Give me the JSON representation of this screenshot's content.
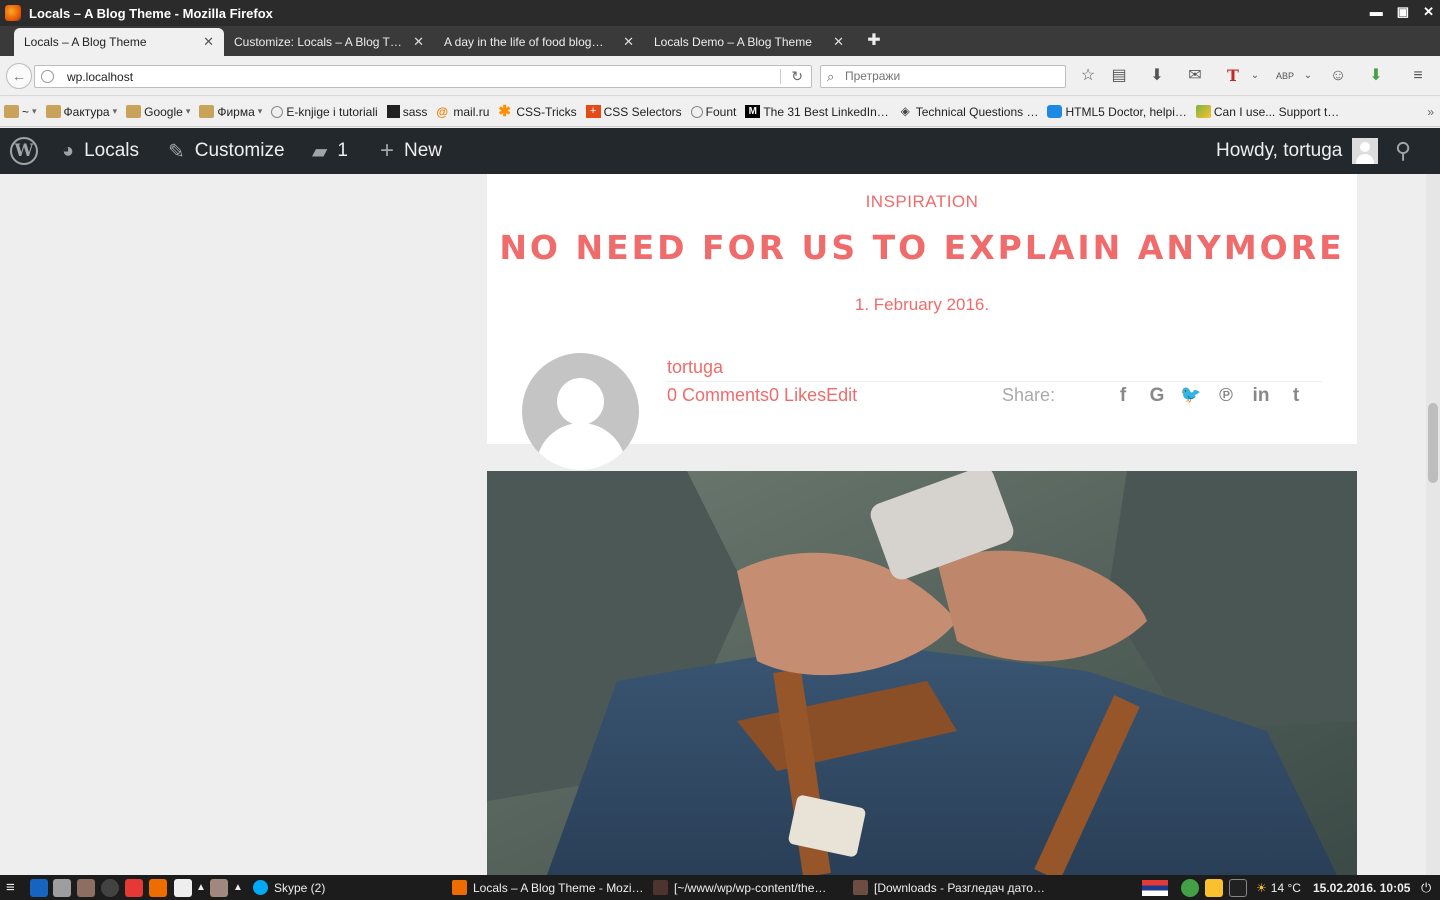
{
  "window": {
    "title": "Locals – A Blog Theme - Mozilla Firefox"
  },
  "tabs": [
    {
      "label": "Locals – A Blog Theme",
      "active": true
    },
    {
      "label": "Customize: Locals – A Blog T…",
      "active": false
    },
    {
      "label": "A day in the life of food blog…",
      "active": false
    },
    {
      "label": "Locals Demo – A Blog Theme",
      "active": false
    }
  ],
  "nav": {
    "url": "wp.localhost",
    "search_placeholder": "Претражи"
  },
  "bookmarks": [
    {
      "label": "~",
      "icon": "folder-icon",
      "dropdown": true
    },
    {
      "label": "Фактура",
      "icon": "folder-icon",
      "dropdown": true
    },
    {
      "label": "Google",
      "icon": "folder-icon",
      "dropdown": true
    },
    {
      "label": "Фирма",
      "icon": "folder-icon",
      "dropdown": true
    },
    {
      "label": "E-knjige i tutoriali",
      "icon": "globe-icon",
      "dropdown": false
    },
    {
      "label": "sass",
      "icon": "sass-icon",
      "dropdown": false
    },
    {
      "label": "mail.ru",
      "icon": "mailru-icon",
      "dropdown": false
    },
    {
      "label": "CSS-Tricks",
      "icon": "asterisk-icon",
      "dropdown": false
    },
    {
      "label": "CSS Selectors",
      "icon": "plus-icon",
      "dropdown": false
    },
    {
      "label": "Fount",
      "icon": "globe-icon",
      "dropdown": false
    },
    {
      "label": "The 31 Best LinkedIn…",
      "icon": "medium-icon",
      "dropdown": false
    },
    {
      "label": "Technical Questions …",
      "icon": "diamond-icon",
      "dropdown": false
    },
    {
      "label": "HTML5 Doctor, helpi…",
      "icon": "html5doctor-icon",
      "dropdown": false
    },
    {
      "label": "Can I use... Support t…",
      "icon": "caniuse-icon",
      "dropdown": false
    }
  ],
  "adminbar": {
    "site": "Locals",
    "customize": "Customize",
    "comments_count": "1",
    "new": "New",
    "howdy": "Howdy, tortuga"
  },
  "post": {
    "category": "INSPIRATION",
    "title": "NO NEED FOR US TO EXPLAIN ANYMORE",
    "date": "1. February 2016.",
    "author": "tortuga",
    "comments": "0 Comments",
    "likes": "0 Likes",
    "edit": "Edit",
    "share_label": "Share:"
  },
  "share_icons": [
    "facebook-icon",
    "google-icon",
    "twitter-icon",
    "pinterest-icon",
    "linkedin-icon",
    "tumblr-icon"
  ],
  "taskbar": {
    "skype": "Skype (2)",
    "tasks": [
      "Locals – A Blog Theme - Mozi…",
      "[~/www/wp/wp-content/the…",
      "[Downloads - Разгледач дато…"
    ],
    "weather": "14 °C",
    "datetime": "15.02.2016. 10:05"
  },
  "colors": {
    "accent": "#f06b6b",
    "adminbar": "#23282d"
  }
}
